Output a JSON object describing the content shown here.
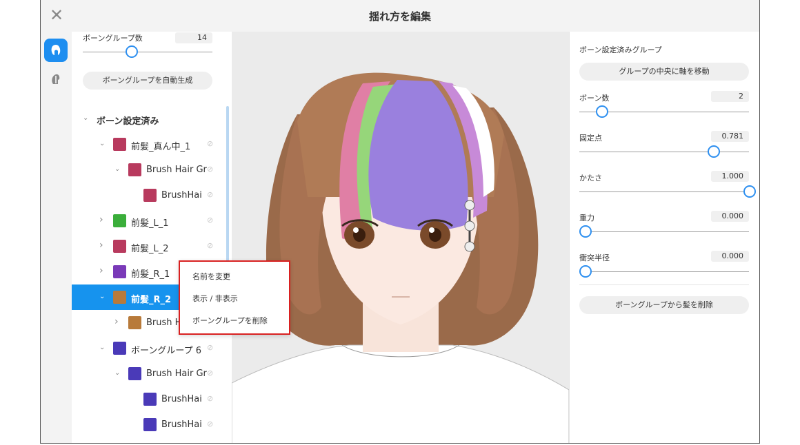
{
  "window": {
    "title": "揺れ方を編集"
  },
  "left": {
    "group_count_label": "ボーングループ数",
    "group_count_value": "14",
    "group_count_level": 0.38,
    "auto_generate_label": "ボーングループを自動生成",
    "tree": [
      {
        "label": "ボーン設定済み",
        "depth": 0,
        "expanded": true,
        "swatch": null,
        "eye": false
      },
      {
        "label": "前髪_真ん中_1",
        "depth": 1,
        "expanded": true,
        "swatch": "#b83a5e",
        "eye": true
      },
      {
        "label": "Brush Hair Gr",
        "depth": 2,
        "expanded": true,
        "swatch": "#b83a5e",
        "eye": true
      },
      {
        "label": "BrushHai",
        "depth": 3,
        "expanded": null,
        "swatch": "#b83a5e",
        "eye": true
      },
      {
        "label": "前髪_L_1",
        "depth": 1,
        "expanded": false,
        "swatch": "#3aae3a",
        "eye": true
      },
      {
        "label": "前髪_L_2",
        "depth": 1,
        "expanded": false,
        "swatch": "#b83a5e",
        "eye": true
      },
      {
        "label": "前髪_R_1",
        "depth": 1,
        "expanded": false,
        "swatch": "#7a3ab8",
        "eye": true
      },
      {
        "label": "前髪_R_2",
        "depth": 1,
        "expanded": true,
        "swatch": "#b87a3a",
        "eye": true,
        "selected": true
      },
      {
        "label": "Brush H",
        "depth": 2,
        "expanded": false,
        "swatch": "#b87a3a",
        "eye": false
      },
      {
        "label": "ボーングループ 6",
        "depth": 1,
        "expanded": true,
        "swatch": "#4a3ab8",
        "eye": true
      },
      {
        "label": "Brush Hair Gr",
        "depth": 2,
        "expanded": true,
        "swatch": "#4a3ab8",
        "eye": true
      },
      {
        "label": "BrushHai",
        "depth": 3,
        "expanded": null,
        "swatch": "#4a3ab8",
        "eye": true
      },
      {
        "label": "BrushHai",
        "depth": 3,
        "expanded": null,
        "swatch": "#4a3ab8",
        "eye": true
      }
    ]
  },
  "context_menu": {
    "rename": "名前を変更",
    "toggle_visibility": "表示 / 非表示",
    "delete_group": "ボーングループを削除"
  },
  "right": {
    "section_title": "ボーン設定済みグループ",
    "center_axis_button": "グループの中央に軸を移動",
    "params": [
      {
        "label": "ボーン数",
        "value": "2",
        "level": 0.1
      },
      {
        "label": "固定点",
        "value": "0.781",
        "level": 0.781
      },
      {
        "label": "かたさ",
        "value": "1.000",
        "level": 1.0
      },
      {
        "label": "重力",
        "value": "0.000",
        "level": 0.0
      },
      {
        "label": "衝突半径",
        "value": "0.000",
        "level": 0.0
      }
    ],
    "remove_hair_button": "ボーングループから髪を削除"
  },
  "colors": {
    "accent": "#2d8ff0",
    "selection": "#1693ee",
    "menu_highlight_border": "#d92020"
  }
}
